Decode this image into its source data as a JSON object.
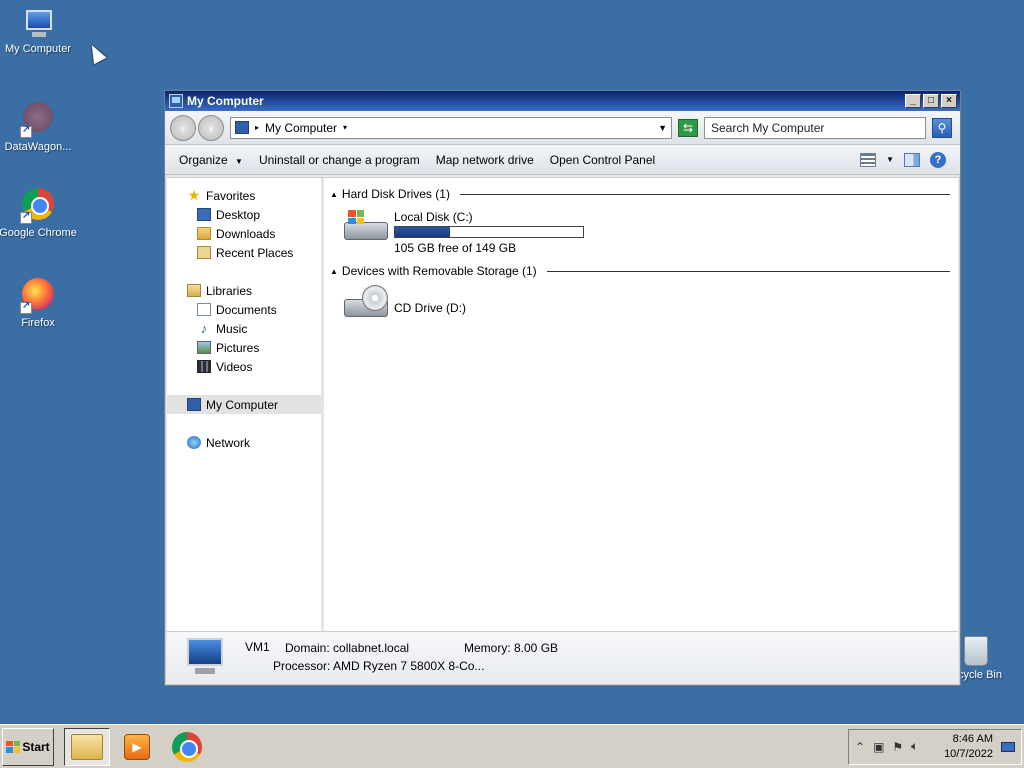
{
  "desktop": {
    "icons": [
      {
        "label": "My Computer"
      },
      {
        "label": "DataWagon..."
      },
      {
        "label": "Google Chrome"
      },
      {
        "label": "Firefox"
      }
    ],
    "recycle_label": "cycle Bin"
  },
  "window": {
    "title": "My Computer",
    "controls": {
      "minimize": "_",
      "maximize": "□",
      "close": "×"
    },
    "address": {
      "path": "My Computer"
    },
    "search": {
      "placeholder": "Search My Computer"
    },
    "commands": [
      {
        "label": "Organize"
      },
      {
        "label": "Uninstall or change a program"
      },
      {
        "label": "Map network drive"
      },
      {
        "label": "Open Control Panel"
      }
    ],
    "nav": {
      "favorites": "Favorites",
      "desktop": "Desktop",
      "downloads": "Downloads",
      "recent": "Recent Places",
      "libraries": "Libraries",
      "documents": "Documents",
      "music": "Music",
      "pictures": "Pictures",
      "videos": "Videos",
      "my_computer": "My Computer",
      "network": "Network"
    },
    "groups": {
      "hdd": "Hard Disk Drives (1)",
      "removable": "Devices with Removable Storage (1)"
    },
    "drives": {
      "c": {
        "name": "Local Disk (C:)",
        "free_text": "105 GB free of 149 GB",
        "used_fraction": 0.295
      },
      "d": {
        "name": "CD Drive (D:)"
      }
    },
    "details": {
      "name": "VM1",
      "domain": "Domain: collabnet.local",
      "memory": "Memory: 8.00 GB",
      "processor": "Processor: AMD Ryzen 7 5800X 8-Co..."
    }
  },
  "taskbar": {
    "start": "Start",
    "time": "8:46 AM",
    "date": "10/7/2022"
  },
  "colors": {
    "desktop": "#3a6ea5",
    "titlebar": "#0a246a",
    "disk_bar": "#1a3a7e"
  }
}
